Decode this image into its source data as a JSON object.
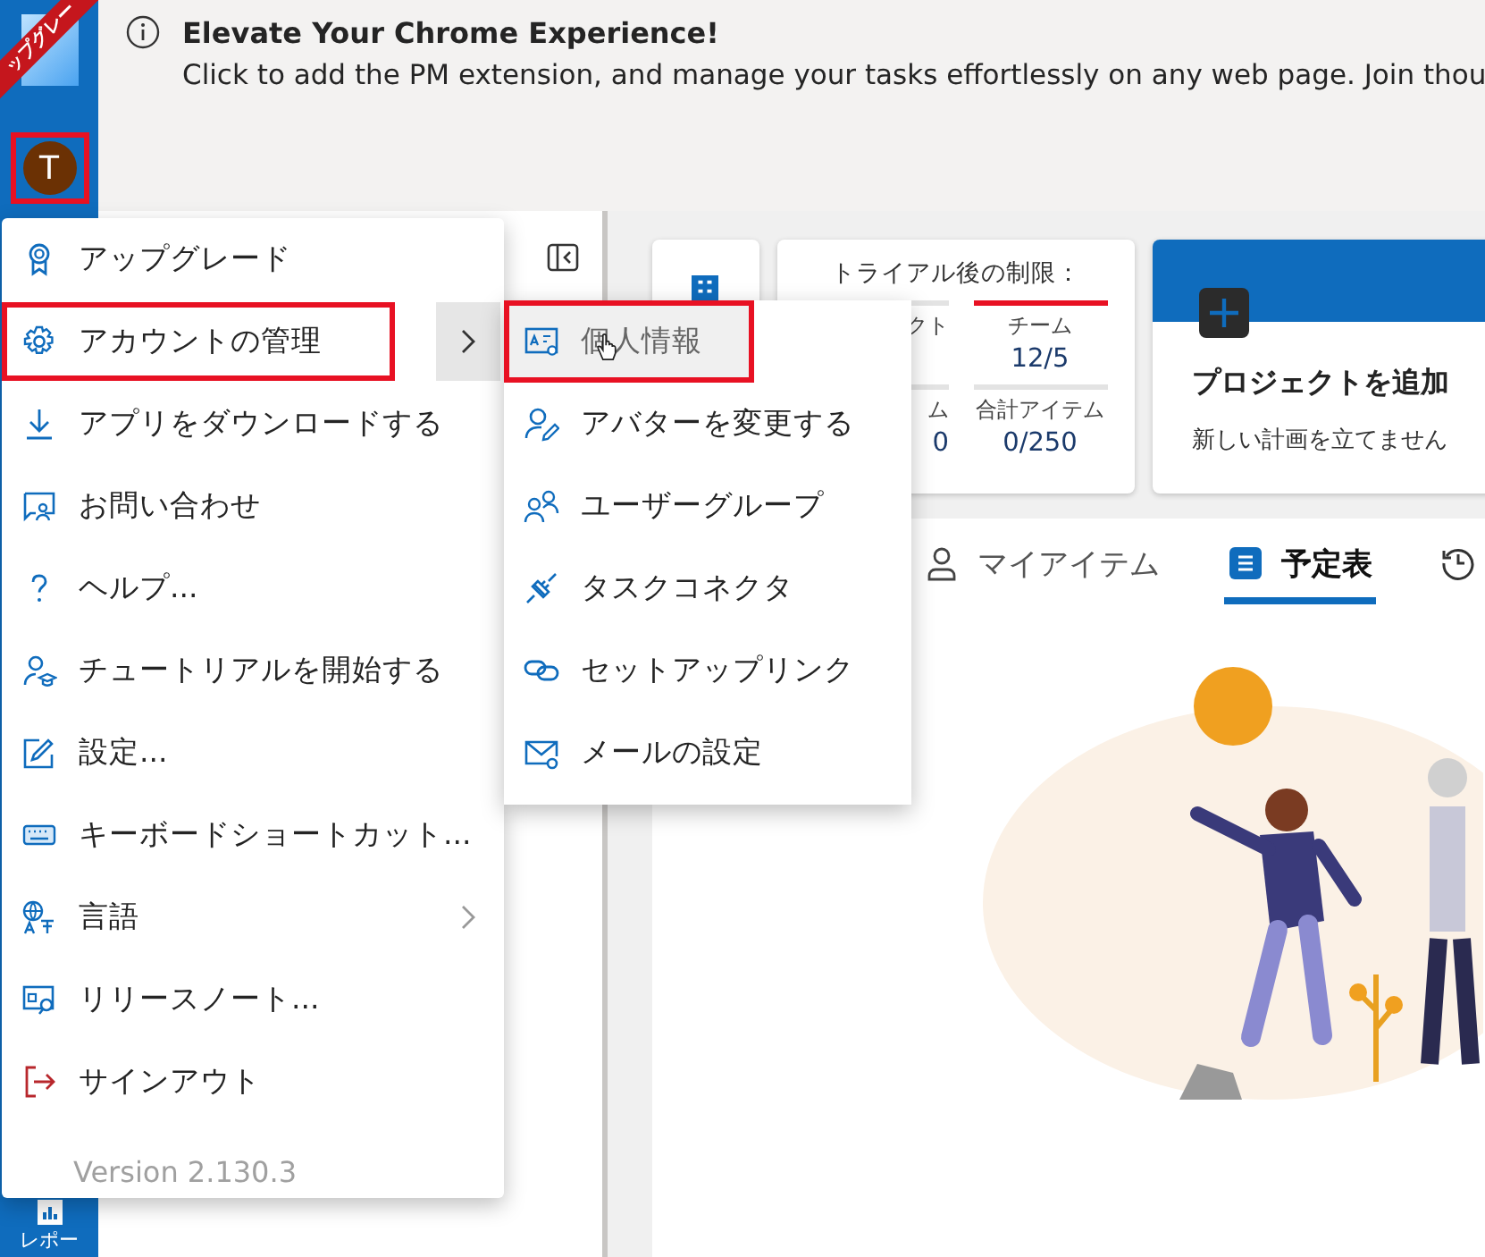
{
  "rail": {
    "ribbon": "ップグレー",
    "avatar": {
      "initial": "T",
      "annotated": true
    },
    "bottom_item": {
      "label": "レポー"
    }
  },
  "banner": {
    "title": "Elevate Your Chrome Experience!",
    "text": "Click to add the PM extension, and manage your tasks effortlessly on any web page. Join thou"
  },
  "menu": {
    "items": [
      {
        "label": "アップグレード",
        "submenu": false,
        "expanded": false,
        "annotated": false
      },
      {
        "label": "アカウントの管理",
        "submenu": true,
        "expanded": true,
        "annotated": true
      },
      {
        "label": "アプリをダウンロードする",
        "submenu": false,
        "expanded": false,
        "annotated": false
      },
      {
        "label": "お問い合わせ",
        "submenu": false,
        "expanded": false,
        "annotated": false
      },
      {
        "label": "ヘルプ...",
        "submenu": false,
        "expanded": false,
        "annotated": false
      },
      {
        "label": "チュートリアルを開始する",
        "submenu": false,
        "expanded": false,
        "annotated": false
      },
      {
        "label": "設定...",
        "submenu": false,
        "expanded": false,
        "annotated": false
      },
      {
        "label": "キーボードショートカット...",
        "submenu": false,
        "expanded": false,
        "annotated": false
      },
      {
        "label": "言語",
        "submenu": true,
        "expanded": false,
        "annotated": false
      },
      {
        "label": "リリースノート...",
        "submenu": false,
        "expanded": false,
        "annotated": false
      },
      {
        "label": "サインアウト",
        "submenu": false,
        "expanded": false,
        "annotated": false
      }
    ],
    "version": "Version 2.130.3"
  },
  "submenu": {
    "items": [
      {
        "label": "個人情報",
        "hovered": true,
        "annotated": true
      },
      {
        "label": "アバターを変更する",
        "hovered": false,
        "annotated": false
      },
      {
        "label": "ユーザーグループ",
        "hovered": false,
        "annotated": false
      },
      {
        "label": "タスクコネクタ",
        "hovered": false,
        "annotated": false
      },
      {
        "label": "セットアップリンク",
        "hovered": false,
        "annotated": false
      },
      {
        "label": "メールの設定",
        "hovered": false,
        "annotated": false
      }
    ]
  },
  "limits_card": {
    "title": "トライアル後の制限：",
    "cells": [
      {
        "label": "クト",
        "exceeded": false
      },
      {
        "label": "チーム",
        "value": "12/5",
        "exceeded": true
      },
      {
        "label": "ム",
        "value": "0",
        "exceeded": false
      },
      {
        "label": "合計アイテム",
        "value": "0/250",
        "exceeded": false
      }
    ]
  },
  "project_card": {
    "title": "プロジェクトを追加",
    "text": "新しい計画を立てません"
  },
  "tabs": [
    {
      "label": "マイアイテム",
      "selected": false
    },
    {
      "label": "予定表",
      "selected": true
    },
    {
      "selected": false
    }
  ]
}
